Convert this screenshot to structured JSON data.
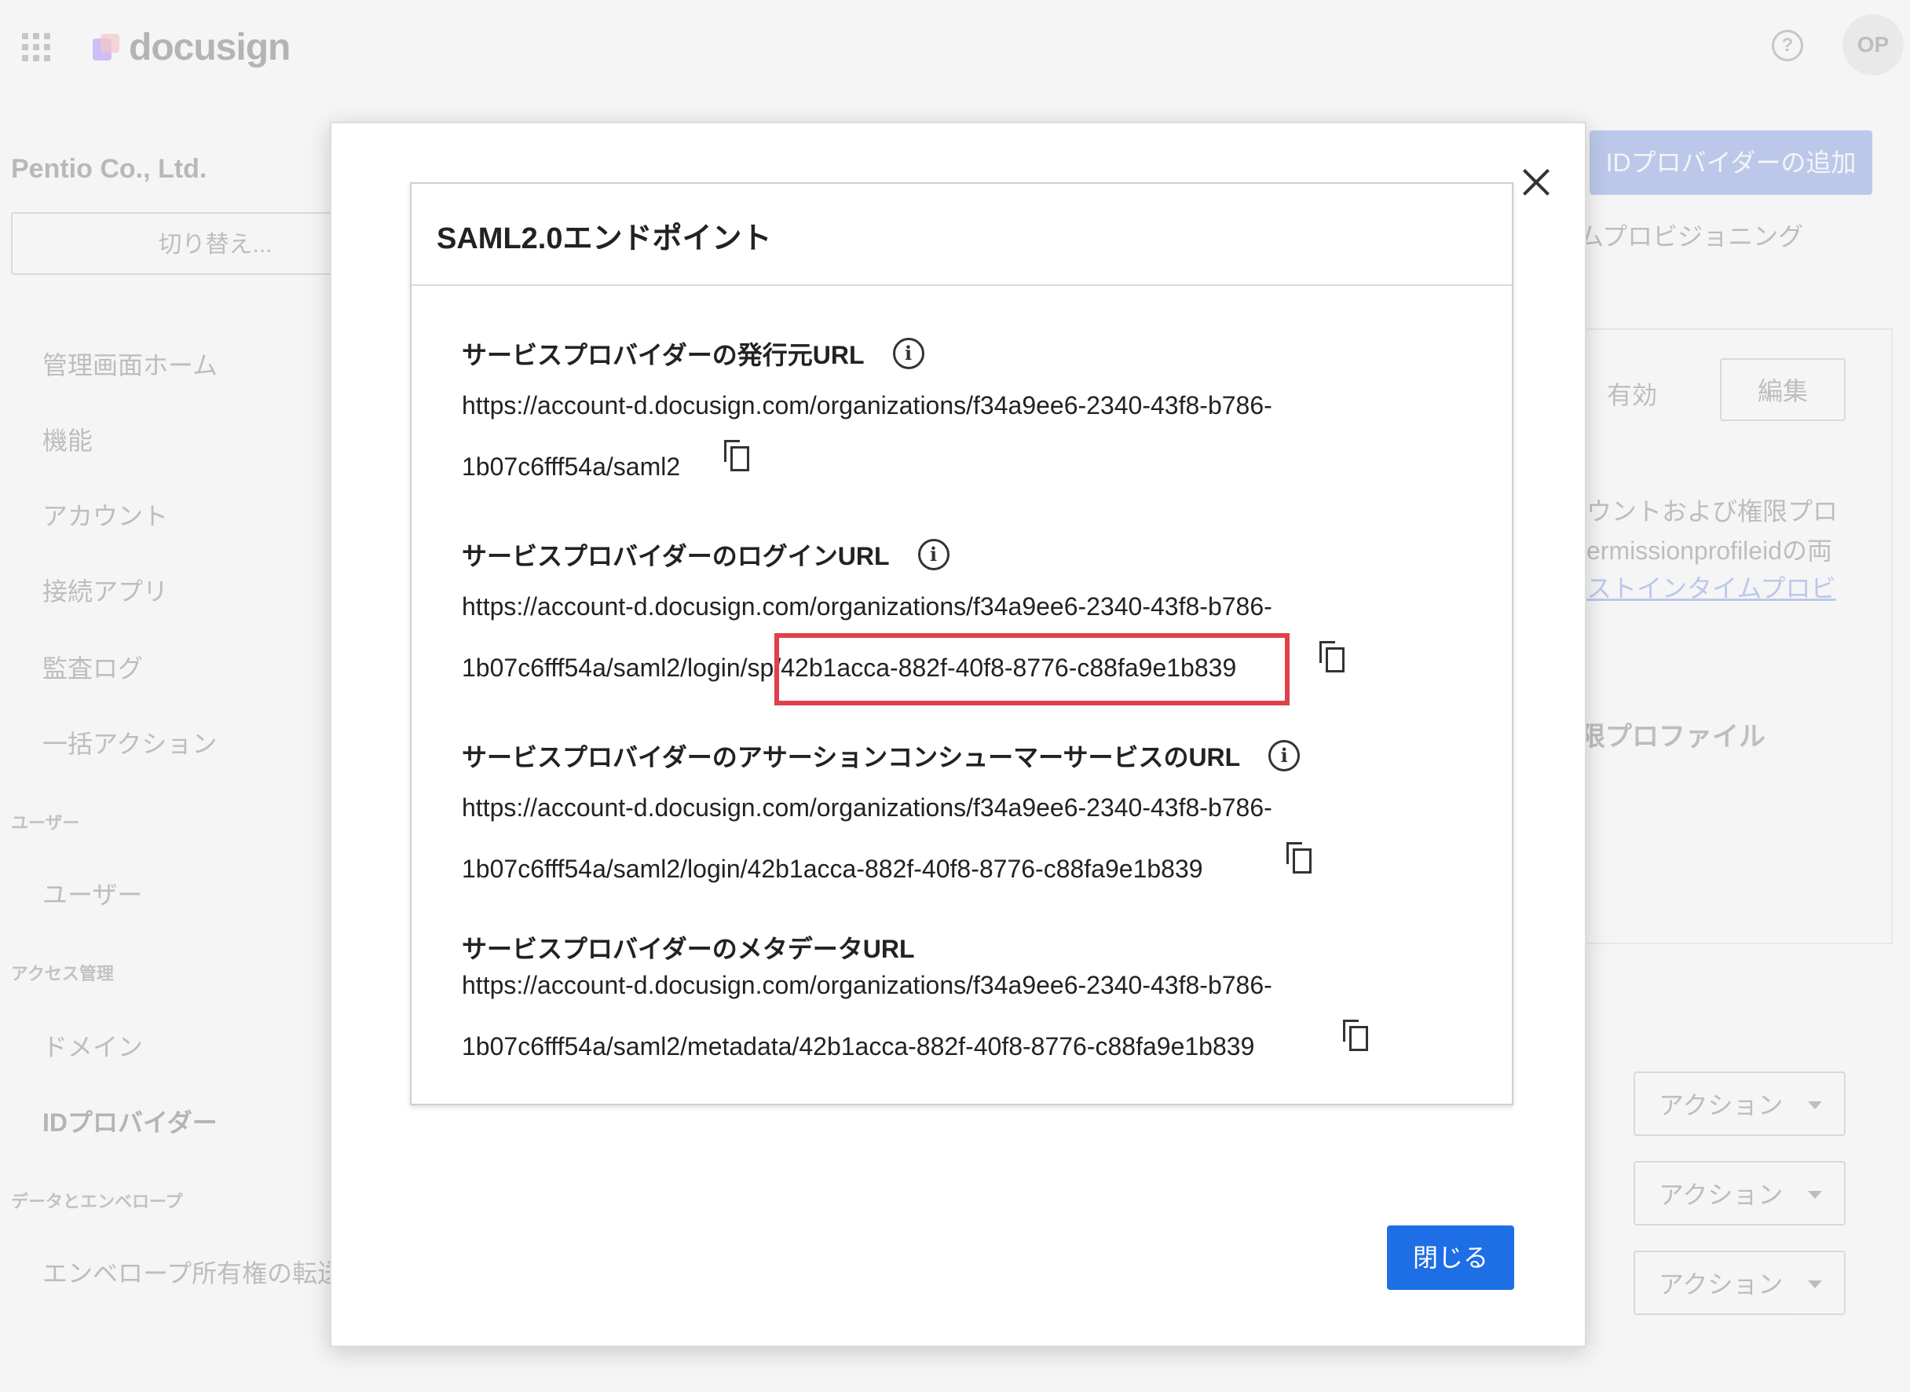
{
  "app": {
    "logo_text": "docusign",
    "avatar_initials": "OP",
    "help_symbol": "?"
  },
  "sidebar": {
    "org_name": "Pentio Co., Ltd.",
    "switch_label": "切り替え...",
    "items": [
      {
        "label": "管理画面ホーム"
      },
      {
        "label": "機能"
      },
      {
        "label": "アカウント"
      },
      {
        "label": "接続アプリ"
      },
      {
        "label": "監査ログ"
      },
      {
        "label": "一括アクション"
      }
    ],
    "section_users": "ユーザー",
    "users_item": "ユーザー",
    "section_access": "アクセス管理",
    "access_items": [
      {
        "label": "ドメイン"
      },
      {
        "label": "IDプロバイダー"
      }
    ],
    "section_data": "データとエンベロープ",
    "data_item": "エンベロープ所有権の転送"
  },
  "background_main": {
    "add_idp_label": "IDプロバイダーの追加",
    "jit_text": "ムプロビジョニング",
    "status": "有効",
    "edit_label": "編集",
    "panel_lines": [
      "ウントおよび権限プロ",
      "ermissionprofileidの両",
      "ストインタイムプロビ"
    ],
    "perm_profile": "限プロファイル",
    "action_label": "アクション"
  },
  "modal": {
    "card_title": "SAML2.0エンドポイント",
    "sections": [
      {
        "label": "サービスプロバイダーの発行元URL",
        "url_line1": "https://account-d.docusign.com/organizations/f34a9ee6-2340-43f8-b786-",
        "url_line2": "1b07c6fff54a/saml2"
      },
      {
        "label": "サービスプロバイダーのログインURL",
        "url_line1": "https://account-d.docusign.com/organizations/f34a9ee6-2340-43f8-b786-",
        "url_line2": "1b07c6fff54a/saml2/login/sp/42b1acca-882f-40f8-8776-c88fa9e1b839"
      },
      {
        "label": "サービスプロバイダーのアサーションコンシューマーサービスのURL",
        "url_line1": "https://account-d.docusign.com/organizations/f34a9ee6-2340-43f8-b786-",
        "url_line2": "1b07c6fff54a/saml2/login/42b1acca-882f-40f8-8776-c88fa9e1b839"
      },
      {
        "label": "サービスプロバイダーのメタデータURL",
        "url_line1": "https://account-d.docusign.com/organizations/f34a9ee6-2340-43f8-b786-",
        "url_line2": "1b07c6fff54a/saml2/metadata/42b1acca-882f-40f8-8776-c88fa9e1b839"
      }
    ],
    "info_symbol": "i",
    "close_button_label": "閉じる",
    "highlight_color": "#e0404a",
    "primary_color": "#1e6ee6"
  }
}
